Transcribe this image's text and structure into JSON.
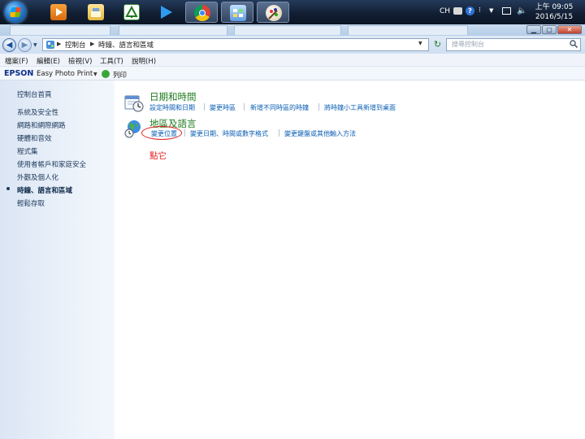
{
  "taskbar": {
    "tray_lang": "CH",
    "clock_time": "上午 09:05",
    "clock_date": "2016/5/15"
  },
  "window": {
    "breadcrumb_root": "控制台",
    "breadcrumb_current": "時鐘、語言和區域",
    "search_placeholder": "搜尋控制台"
  },
  "menu": [
    "檔案(F)",
    "編輯(E)",
    "檢視(V)",
    "工具(T)",
    "說明(H)"
  ],
  "epson": {
    "brand": "EPSON",
    "product": "Easy Photo Print",
    "print_label": "列印"
  },
  "sidebar": {
    "items": [
      "控制台首頁",
      "系統及安全性",
      "網路和網際網路",
      "硬體和音效",
      "程式集",
      "使用者帳戶和家庭安全",
      "外觀及個人化",
      "時鐘、語言和區域",
      "輕鬆存取"
    ],
    "active_index": 7
  },
  "content": {
    "section1": {
      "title": "日期和時間",
      "links": [
        "設定時間和日期",
        "變更時區",
        "新增不同時區的時鐘",
        "將時鐘小工具新增到桌面"
      ]
    },
    "section2": {
      "title": "地區及語言",
      "links": [
        "變更位置",
        "變更日期、時間或數字格式",
        "變更鍵盤或其他輸入方法"
      ]
    },
    "annotation": "點它",
    "colors": {
      "section_title": "#1e7a1e",
      "link": "#0a5fb4",
      "annotation": "#e02020"
    }
  }
}
